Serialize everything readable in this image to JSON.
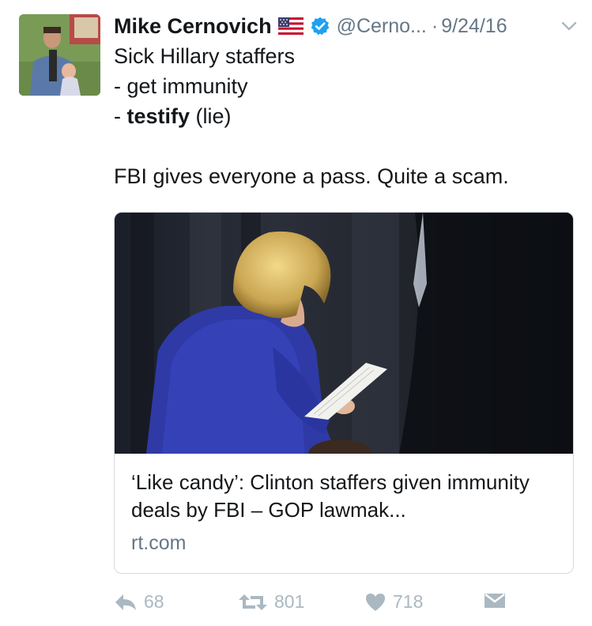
{
  "tweet": {
    "author_name": "Mike Cernovich",
    "handle": "@Cerno...",
    "separator": "·",
    "date": "9/24/16",
    "text_lines": [
      {
        "prefix": "",
        "bold": "",
        "rest": "Sick Hillary staffers"
      },
      {
        "prefix": "- ",
        "bold": "",
        "rest": "get immunity"
      },
      {
        "prefix": "- ",
        "bold": "testify",
        "rest": " (lie)"
      },
      {
        "prefix": "",
        "bold": "",
        "rest": ""
      },
      {
        "prefix": "",
        "bold": "",
        "rest": "FBI gives everyone a pass. Quite a scam."
      }
    ]
  },
  "card": {
    "title": "‘Like candy’: Clinton staffers given immunity deals by FBI – GOP lawmak...",
    "domain": "rt.com"
  },
  "actions": {
    "reply_count": "68",
    "retweet_count": "801",
    "like_count": "718"
  },
  "icons": {
    "flag": "us-flag-icon",
    "verified": "verified-badge-icon",
    "chevron": "chevron-down-icon",
    "reply": "reply-icon",
    "retweet": "retweet-icon",
    "like": "heart-icon",
    "dm": "envelope-icon"
  },
  "colors": {
    "verified": "#1da1f2",
    "muted": "#657786",
    "action": "#aab8c2"
  }
}
